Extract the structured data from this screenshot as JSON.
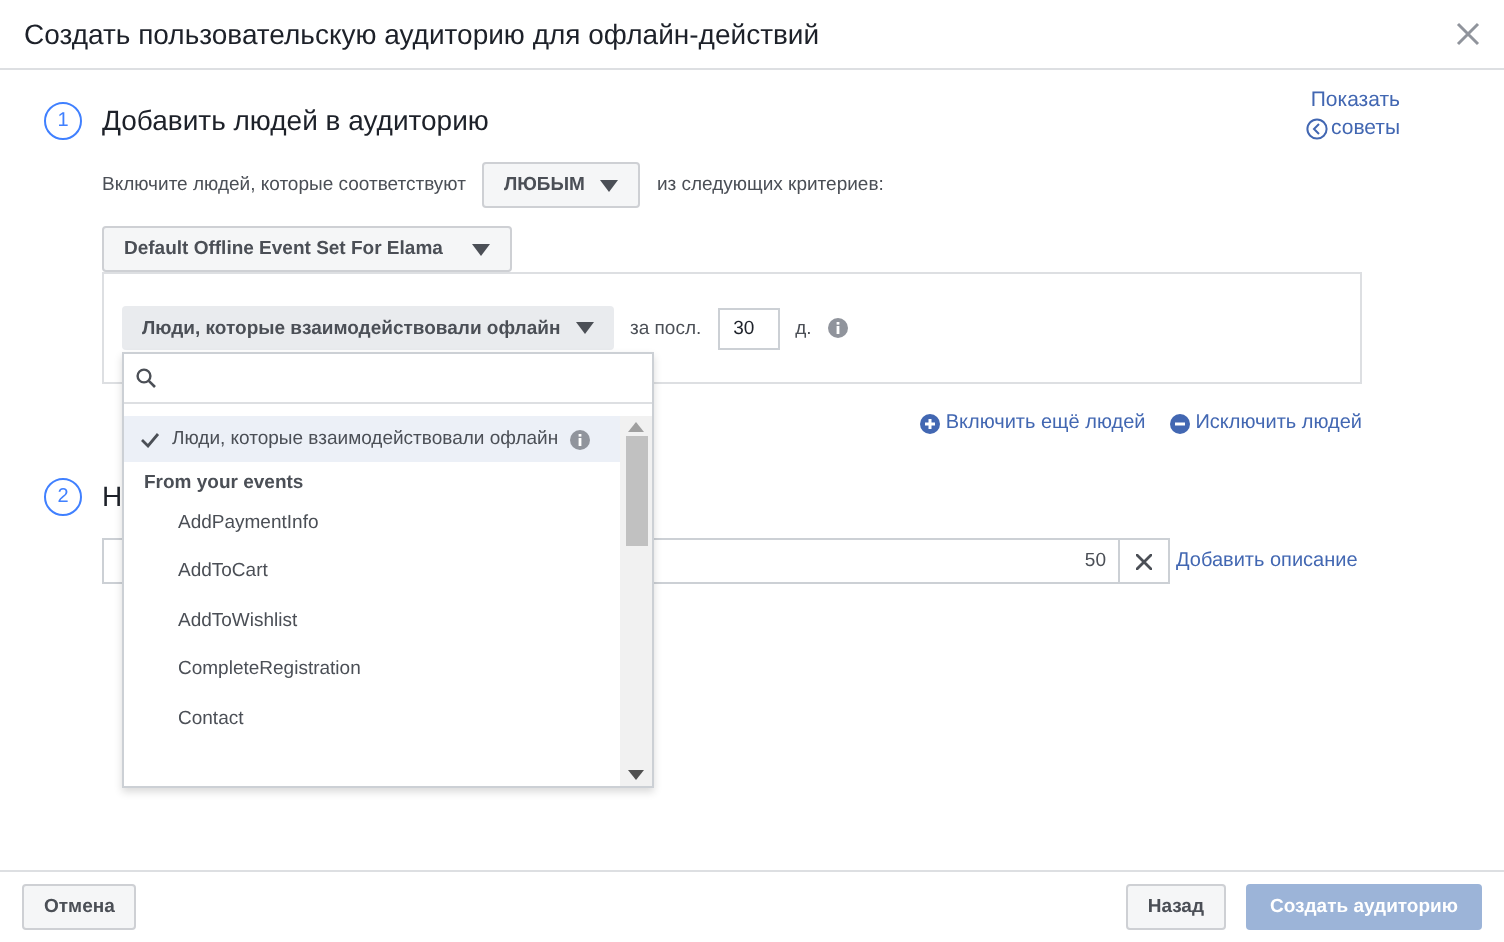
{
  "dialog": {
    "title": "Создать пользовательскую аудиторию для офлайн-действий"
  },
  "tips_link": {
    "line1": "Показать",
    "line2": "советы"
  },
  "section_1": {
    "number": "1",
    "title": "Добавить людей в аудиторию",
    "include_prefix": "Включите людей, которые соответствуют",
    "match_dropdown": "ЛЮБЫМ",
    "include_suffix": "из следующих критериев:",
    "event_set_dropdown": "Default Offline Event Set For Elama",
    "rule": {
      "dropdown": "Люди, которые взаимодействовали офлайн",
      "period_label": "за посл.",
      "period_value": "30",
      "unit": "д."
    },
    "include_more_link": "Включить ещё людей",
    "exclude_link": "Исключить людей"
  },
  "dropdown_menu": {
    "items": [
      {
        "kind": "option",
        "label": "Люди, которые взаимодействовали офлайн",
        "selected": true,
        "info": true
      },
      {
        "kind": "header",
        "label": "From your events"
      },
      {
        "kind": "option",
        "label": "AddPaymentInfo",
        "selected": false
      },
      {
        "kind": "option",
        "label": "AddToCart",
        "selected": false
      },
      {
        "kind": "option",
        "label": "AddToWishlist",
        "selected": false
      },
      {
        "kind": "option",
        "label": "CompleteRegistration",
        "selected": false
      },
      {
        "kind": "option",
        "label": "Contact",
        "selected": false
      }
    ]
  },
  "section_2": {
    "number": "2",
    "title": "Н",
    "name_field": {
      "counter": "50"
    },
    "add_description_link": "Добавить описание"
  },
  "footer": {
    "cancel": "Отмена",
    "back": "Назад",
    "create": {
      "label": "Создать аудиторию",
      "disabled": true
    }
  }
}
